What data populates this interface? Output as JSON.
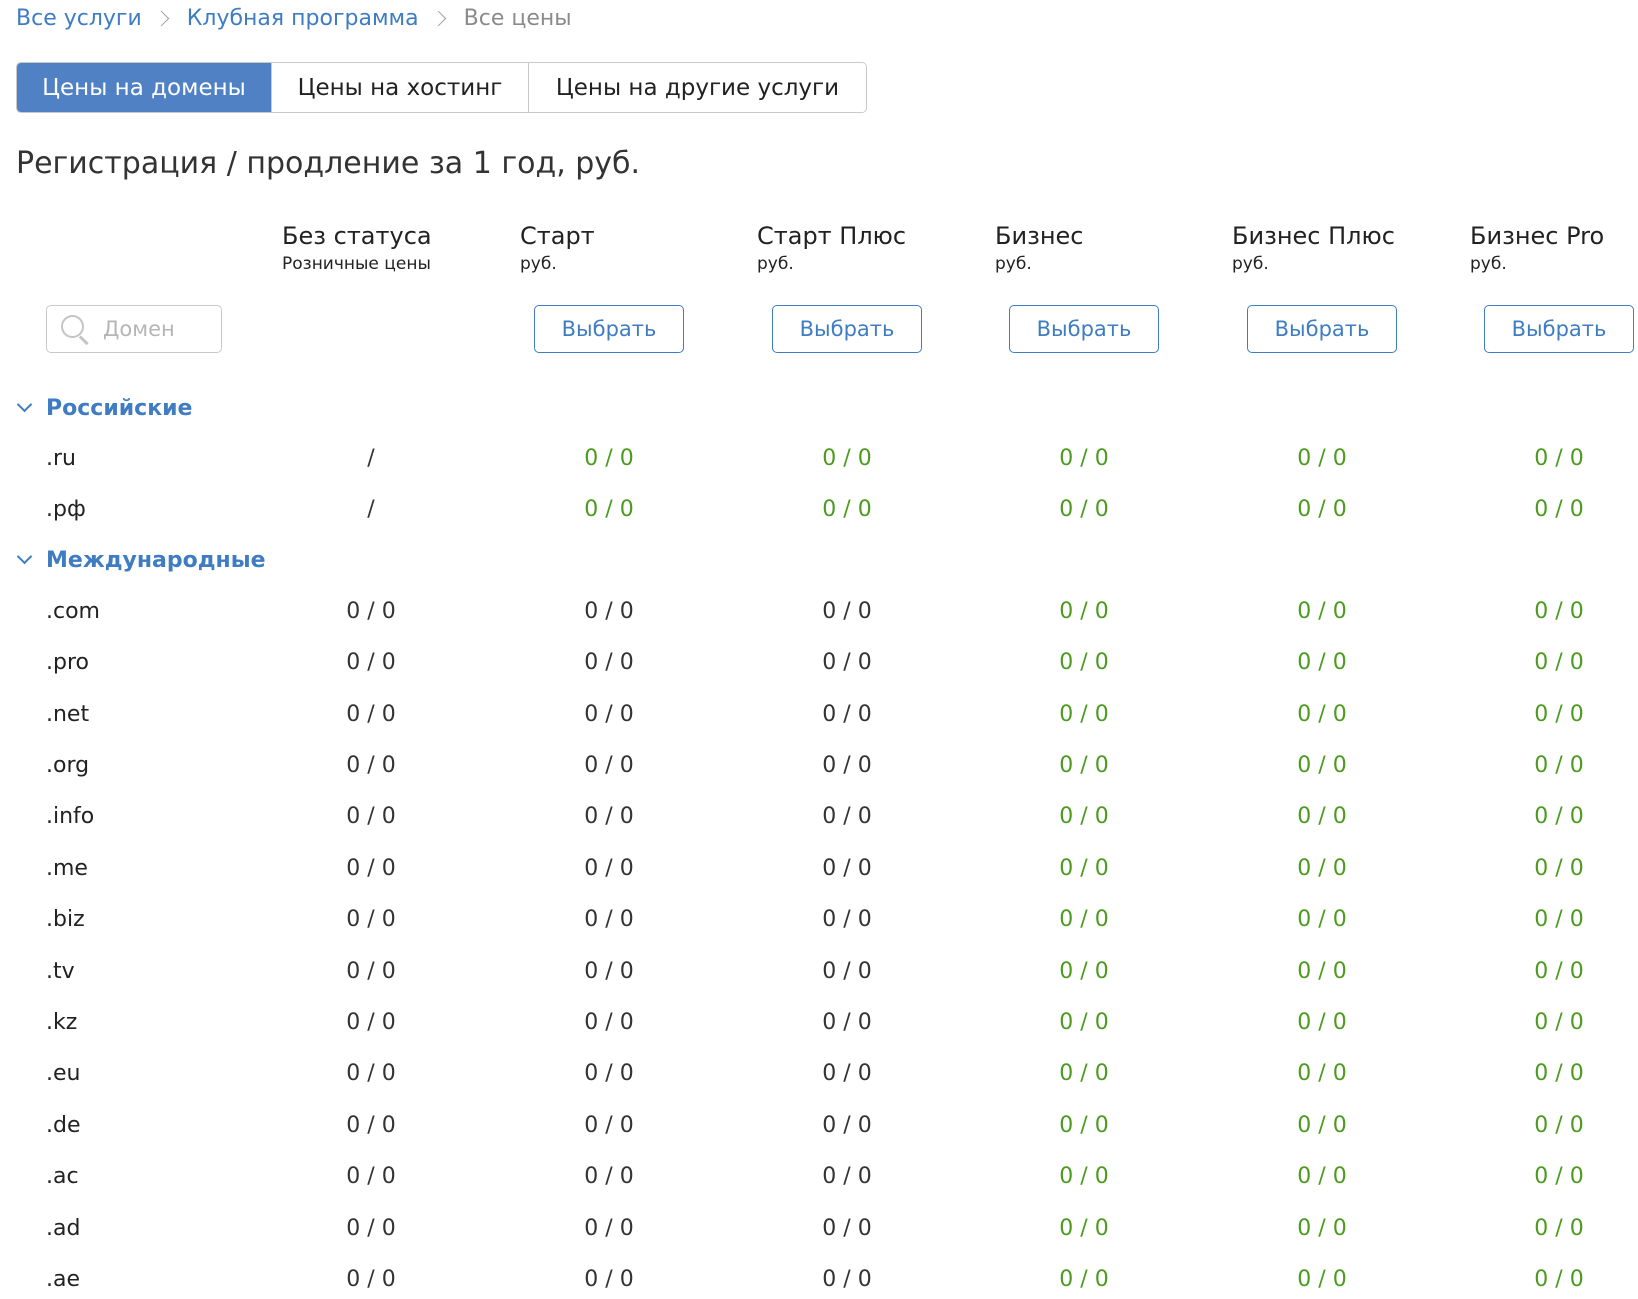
{
  "breadcrumb": {
    "items": [
      "Все услуги",
      "Клубная программа"
    ],
    "current": "Все цены"
  },
  "tabs": [
    {
      "label": "Цены на домены",
      "active": true
    },
    {
      "label": "Цены на хостинг",
      "active": false
    },
    {
      "label": "Цены на другие услуги",
      "active": false
    }
  ],
  "page_title": "Регистрация / продление за 1 год, руб.",
  "search": {
    "placeholder": "Домен",
    "value": ""
  },
  "columns": [
    {
      "name": "Без статуса",
      "sub": "Розничные цены",
      "button": null
    },
    {
      "name": "Старт",
      "sub": "руб.",
      "button": "Выбрать"
    },
    {
      "name": "Старт Плюс",
      "sub": "руб.",
      "button": "Выбрать"
    },
    {
      "name": "Бизнес",
      "sub": "руб.",
      "button": "Выбрать"
    },
    {
      "name": "Бизнес Плюс",
      "sub": "руб.",
      "button": "Выбрать"
    },
    {
      "name": "Бизнес Pro",
      "sub": "руб.",
      "button": "Выбрать"
    }
  ],
  "colors": {
    "accent": "#3f7cc2",
    "active_tab": "#4f81c4",
    "discount_price": "#4c9b1f",
    "base_price": "#333333"
  },
  "groups": [
    {
      "label": "Российские",
      "rows": [
        {
          "domain": ".ru",
          "prices": [
            "/",
            "0 / 0",
            "0 / 0",
            "0 / 0",
            "0 / 0",
            "0 / 0"
          ],
          "green": [
            false,
            true,
            true,
            true,
            true,
            true
          ]
        },
        {
          "domain": ".рф",
          "prices": [
            "/",
            "0 / 0",
            "0 / 0",
            "0 / 0",
            "0 / 0",
            "0 / 0"
          ],
          "green": [
            false,
            true,
            true,
            true,
            true,
            true
          ]
        }
      ]
    },
    {
      "label": "Международные",
      "rows": [
        {
          "domain": ".com",
          "prices": [
            "0 / 0",
            "0 / 0",
            "0 / 0",
            "0 / 0",
            "0 / 0",
            "0 / 0"
          ],
          "green": [
            false,
            false,
            false,
            true,
            true,
            true
          ]
        },
        {
          "domain": ".pro",
          "prices": [
            "0 / 0",
            "0 / 0",
            "0 / 0",
            "0 / 0",
            "0 / 0",
            "0 / 0"
          ],
          "green": [
            false,
            false,
            false,
            true,
            true,
            true
          ]
        },
        {
          "domain": ".net",
          "prices": [
            "0 / 0",
            "0 / 0",
            "0 / 0",
            "0 / 0",
            "0 / 0",
            "0 / 0"
          ],
          "green": [
            false,
            false,
            false,
            true,
            true,
            true
          ]
        },
        {
          "domain": ".org",
          "prices": [
            "0 / 0",
            "0 / 0",
            "0 / 0",
            "0 / 0",
            "0 / 0",
            "0 / 0"
          ],
          "green": [
            false,
            false,
            false,
            true,
            true,
            true
          ]
        },
        {
          "domain": ".info",
          "prices": [
            "0 / 0",
            "0 / 0",
            "0 / 0",
            "0 / 0",
            "0 / 0",
            "0 / 0"
          ],
          "green": [
            false,
            false,
            false,
            true,
            true,
            true
          ]
        },
        {
          "domain": ".me",
          "prices": [
            "0 / 0",
            "0 / 0",
            "0 / 0",
            "0 / 0",
            "0 / 0",
            "0 / 0"
          ],
          "green": [
            false,
            false,
            false,
            true,
            true,
            true
          ]
        },
        {
          "domain": ".biz",
          "prices": [
            "0 / 0",
            "0 / 0",
            "0 / 0",
            "0 / 0",
            "0 / 0",
            "0 / 0"
          ],
          "green": [
            false,
            false,
            false,
            true,
            true,
            true
          ]
        },
        {
          "domain": ".tv",
          "prices": [
            "0 / 0",
            "0 / 0",
            "0 / 0",
            "0 / 0",
            "0 / 0",
            "0 / 0"
          ],
          "green": [
            false,
            false,
            false,
            true,
            true,
            true
          ]
        },
        {
          "domain": ".kz",
          "prices": [
            "0 / 0",
            "0 / 0",
            "0 / 0",
            "0 / 0",
            "0 / 0",
            "0 / 0"
          ],
          "green": [
            false,
            false,
            false,
            true,
            true,
            true
          ]
        },
        {
          "domain": ".eu",
          "prices": [
            "0 / 0",
            "0 / 0",
            "0 / 0",
            "0 / 0",
            "0 / 0",
            "0 / 0"
          ],
          "green": [
            false,
            false,
            false,
            true,
            true,
            true
          ]
        },
        {
          "domain": ".de",
          "prices": [
            "0 / 0",
            "0 / 0",
            "0 / 0",
            "0 / 0",
            "0 / 0",
            "0 / 0"
          ],
          "green": [
            false,
            false,
            false,
            true,
            true,
            true
          ]
        },
        {
          "domain": ".ac",
          "prices": [
            "0 / 0",
            "0 / 0",
            "0 / 0",
            "0 / 0",
            "0 / 0",
            "0 / 0"
          ],
          "green": [
            false,
            false,
            false,
            true,
            true,
            true
          ]
        },
        {
          "domain": ".ad",
          "prices": [
            "0 / 0",
            "0 / 0",
            "0 / 0",
            "0 / 0",
            "0 / 0",
            "0 / 0"
          ],
          "green": [
            false,
            false,
            false,
            true,
            true,
            true
          ]
        },
        {
          "domain": ".ae",
          "prices": [
            "0 / 0",
            "0 / 0",
            "0 / 0",
            "0 / 0",
            "0 / 0",
            "0 / 0"
          ],
          "green": [
            false,
            false,
            false,
            true,
            true,
            true
          ]
        }
      ]
    }
  ]
}
